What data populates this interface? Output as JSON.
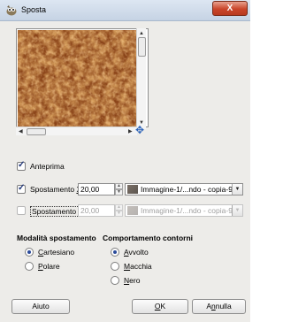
{
  "window": {
    "title": "Sposta",
    "close_label": "X"
  },
  "preview": {
    "checkbox_label": "Anteprima",
    "checked": true
  },
  "spostamento_x": {
    "label_prefix": "Spostamento ",
    "label_key": "X",
    "label_suffix": ":",
    "checked": true,
    "value": "20,00",
    "source": "Immagine-1/...ndo - copia-9"
  },
  "spostamento_y": {
    "label_prefix": "Spostamento ",
    "label_key": "Y",
    "label_suffix": ":",
    "checked": false,
    "value": "20,00",
    "source": "Immagine-1/...ndo - copia-9"
  },
  "modalita": {
    "heading": "Modalità spostamento",
    "options": [
      {
        "key": "C",
        "rest": "artesiano",
        "selected": true
      },
      {
        "key": "P",
        "rest": "olare",
        "selected": false
      }
    ]
  },
  "comportamento": {
    "heading": "Comportamento contorni",
    "options": [
      {
        "key": "A",
        "rest": "vvolto",
        "selected": true
      },
      {
        "key": "M",
        "rest": "acchia",
        "selected": false
      },
      {
        "key": "N",
        "rest": "ero",
        "selected": false
      }
    ]
  },
  "buttons": {
    "help": "Aiuto",
    "ok_key": "O",
    "ok_rest": "K",
    "cancel_pre": "A",
    "cancel_key": "n",
    "cancel_rest": "nulla"
  },
  "icons": {
    "app": "gimp-wilber-icon",
    "navigate": "navigate-arrows-icon",
    "source_thumb": "image-thumbnail-icon",
    "dropdown": "chevron-down-icon"
  }
}
